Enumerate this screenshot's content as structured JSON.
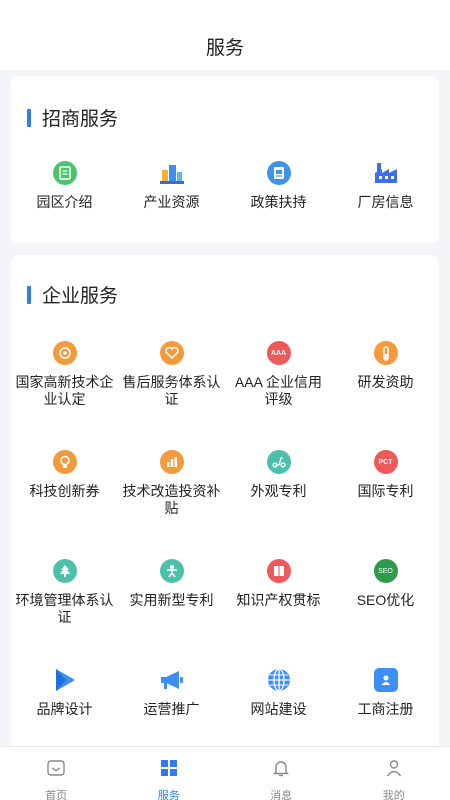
{
  "header": {
    "title": "服务"
  },
  "investment": {
    "title": "招商服务",
    "items": [
      {
        "label": "园区介绍",
        "icon": "document-icon",
        "color": "#4cc46d"
      },
      {
        "label": "产业资源",
        "icon": "city-icon",
        "color": "#3d8ef7"
      },
      {
        "label": "政策扶持",
        "icon": "policy-icon",
        "color": "#3f93e8"
      },
      {
        "label": "厂房信息",
        "icon": "factory-icon",
        "color": "#3c6fe8"
      }
    ]
  },
  "enterprise": {
    "title": "企业服务",
    "items": [
      {
        "label": "国家高新技术企业认定",
        "icon": "high-tech-icon",
        "color": "#f39a3d"
      },
      {
        "label": "售后服务体系认证",
        "icon": "heart-icon",
        "color": "#f39a3d"
      },
      {
        "label": "AAA 企业信用评级",
        "icon": "aaa-icon",
        "color": "#ee5a5a",
        "text": "AAA"
      },
      {
        "label": "研发资助",
        "icon": "test-tube-icon",
        "color": "#f39a3d"
      },
      {
        "label": "科技创新券",
        "icon": "lightbulb-icon",
        "color": "#f39a3d"
      },
      {
        "label": "技术改造投资补贴",
        "icon": "bar-chart-icon",
        "color": "#f39a3d"
      },
      {
        "label": "外观专利",
        "icon": "scooter-icon",
        "color": "#4ec0a9"
      },
      {
        "label": "国际专利",
        "icon": "pct-icon",
        "color": "#ee5a5a",
        "text": "PCT"
      },
      {
        "label": "环境管理体系认证",
        "icon": "tree-icon",
        "color": "#4ec0a9"
      },
      {
        "label": "实用新型专利",
        "icon": "person-icon",
        "color": "#4ec0a9"
      },
      {
        "label": "知识产权贯标",
        "icon": "book-icon",
        "color": "#ee5a5a"
      },
      {
        "label": "SEO优化",
        "icon": "seo-icon",
        "color": "#2e9a4c",
        "text": "SEO"
      },
      {
        "label": "品牌设计",
        "icon": "play-icon",
        "color": "#3d8ef7"
      },
      {
        "label": "运营推广",
        "icon": "megaphone-icon",
        "color": "#3d8ef7"
      },
      {
        "label": "网站建设",
        "icon": "globe-icon",
        "color": "#3d8ef7"
      },
      {
        "label": "工商注册",
        "icon": "id-card-icon",
        "color": "#3d8ef7"
      }
    ]
  },
  "tabs": [
    {
      "label": "首页",
      "icon": "home-icon",
      "active": false
    },
    {
      "label": "服务",
      "icon": "grid-icon",
      "active": true
    },
    {
      "label": "消息",
      "icon": "bell-icon",
      "active": false
    },
    {
      "label": "我的",
      "icon": "user-icon",
      "active": false
    }
  ]
}
